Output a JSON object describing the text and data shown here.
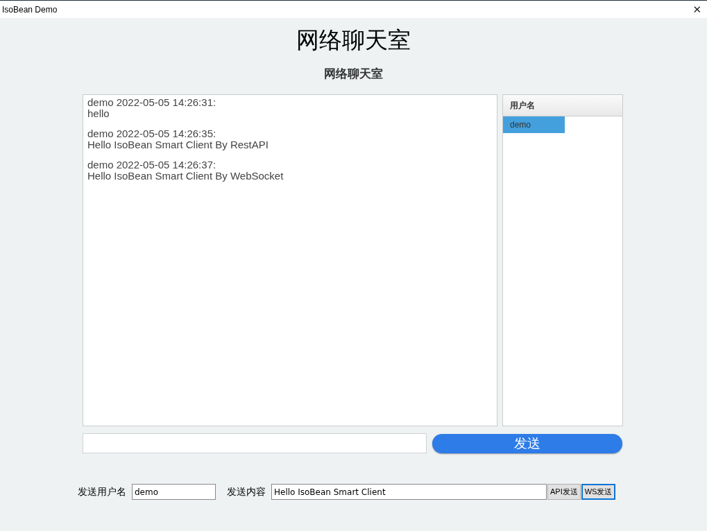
{
  "window": {
    "title": "IsoBean Demo",
    "close": "✕"
  },
  "heading": "网络聊天室",
  "subheading": "网络聊天室",
  "messages": [
    {
      "header": "demo 2022-05-05 14:26:31:",
      "body": "hello"
    },
    {
      "header": "demo 2022-05-05 14:26:35:",
      "body": "Hello IsoBean Smart Client By RestAPI"
    },
    {
      "header": "demo 2022-05-05 14:26:37:",
      "body": "Hello IsoBean Smart Client By WebSocket"
    }
  ],
  "user_list": {
    "header": "用户名",
    "items": [
      {
        "name": "demo",
        "selected": true
      }
    ]
  },
  "send_button": "发送",
  "form": {
    "username_label": "发送用户名",
    "username_value": "demo",
    "content_label": "发送内容",
    "content_value": "Hello IsoBean Smart Client",
    "buttons": [
      {
        "label": "API发送",
        "focused": false
      },
      {
        "label": "WS发送",
        "focused": true
      }
    ]
  }
}
